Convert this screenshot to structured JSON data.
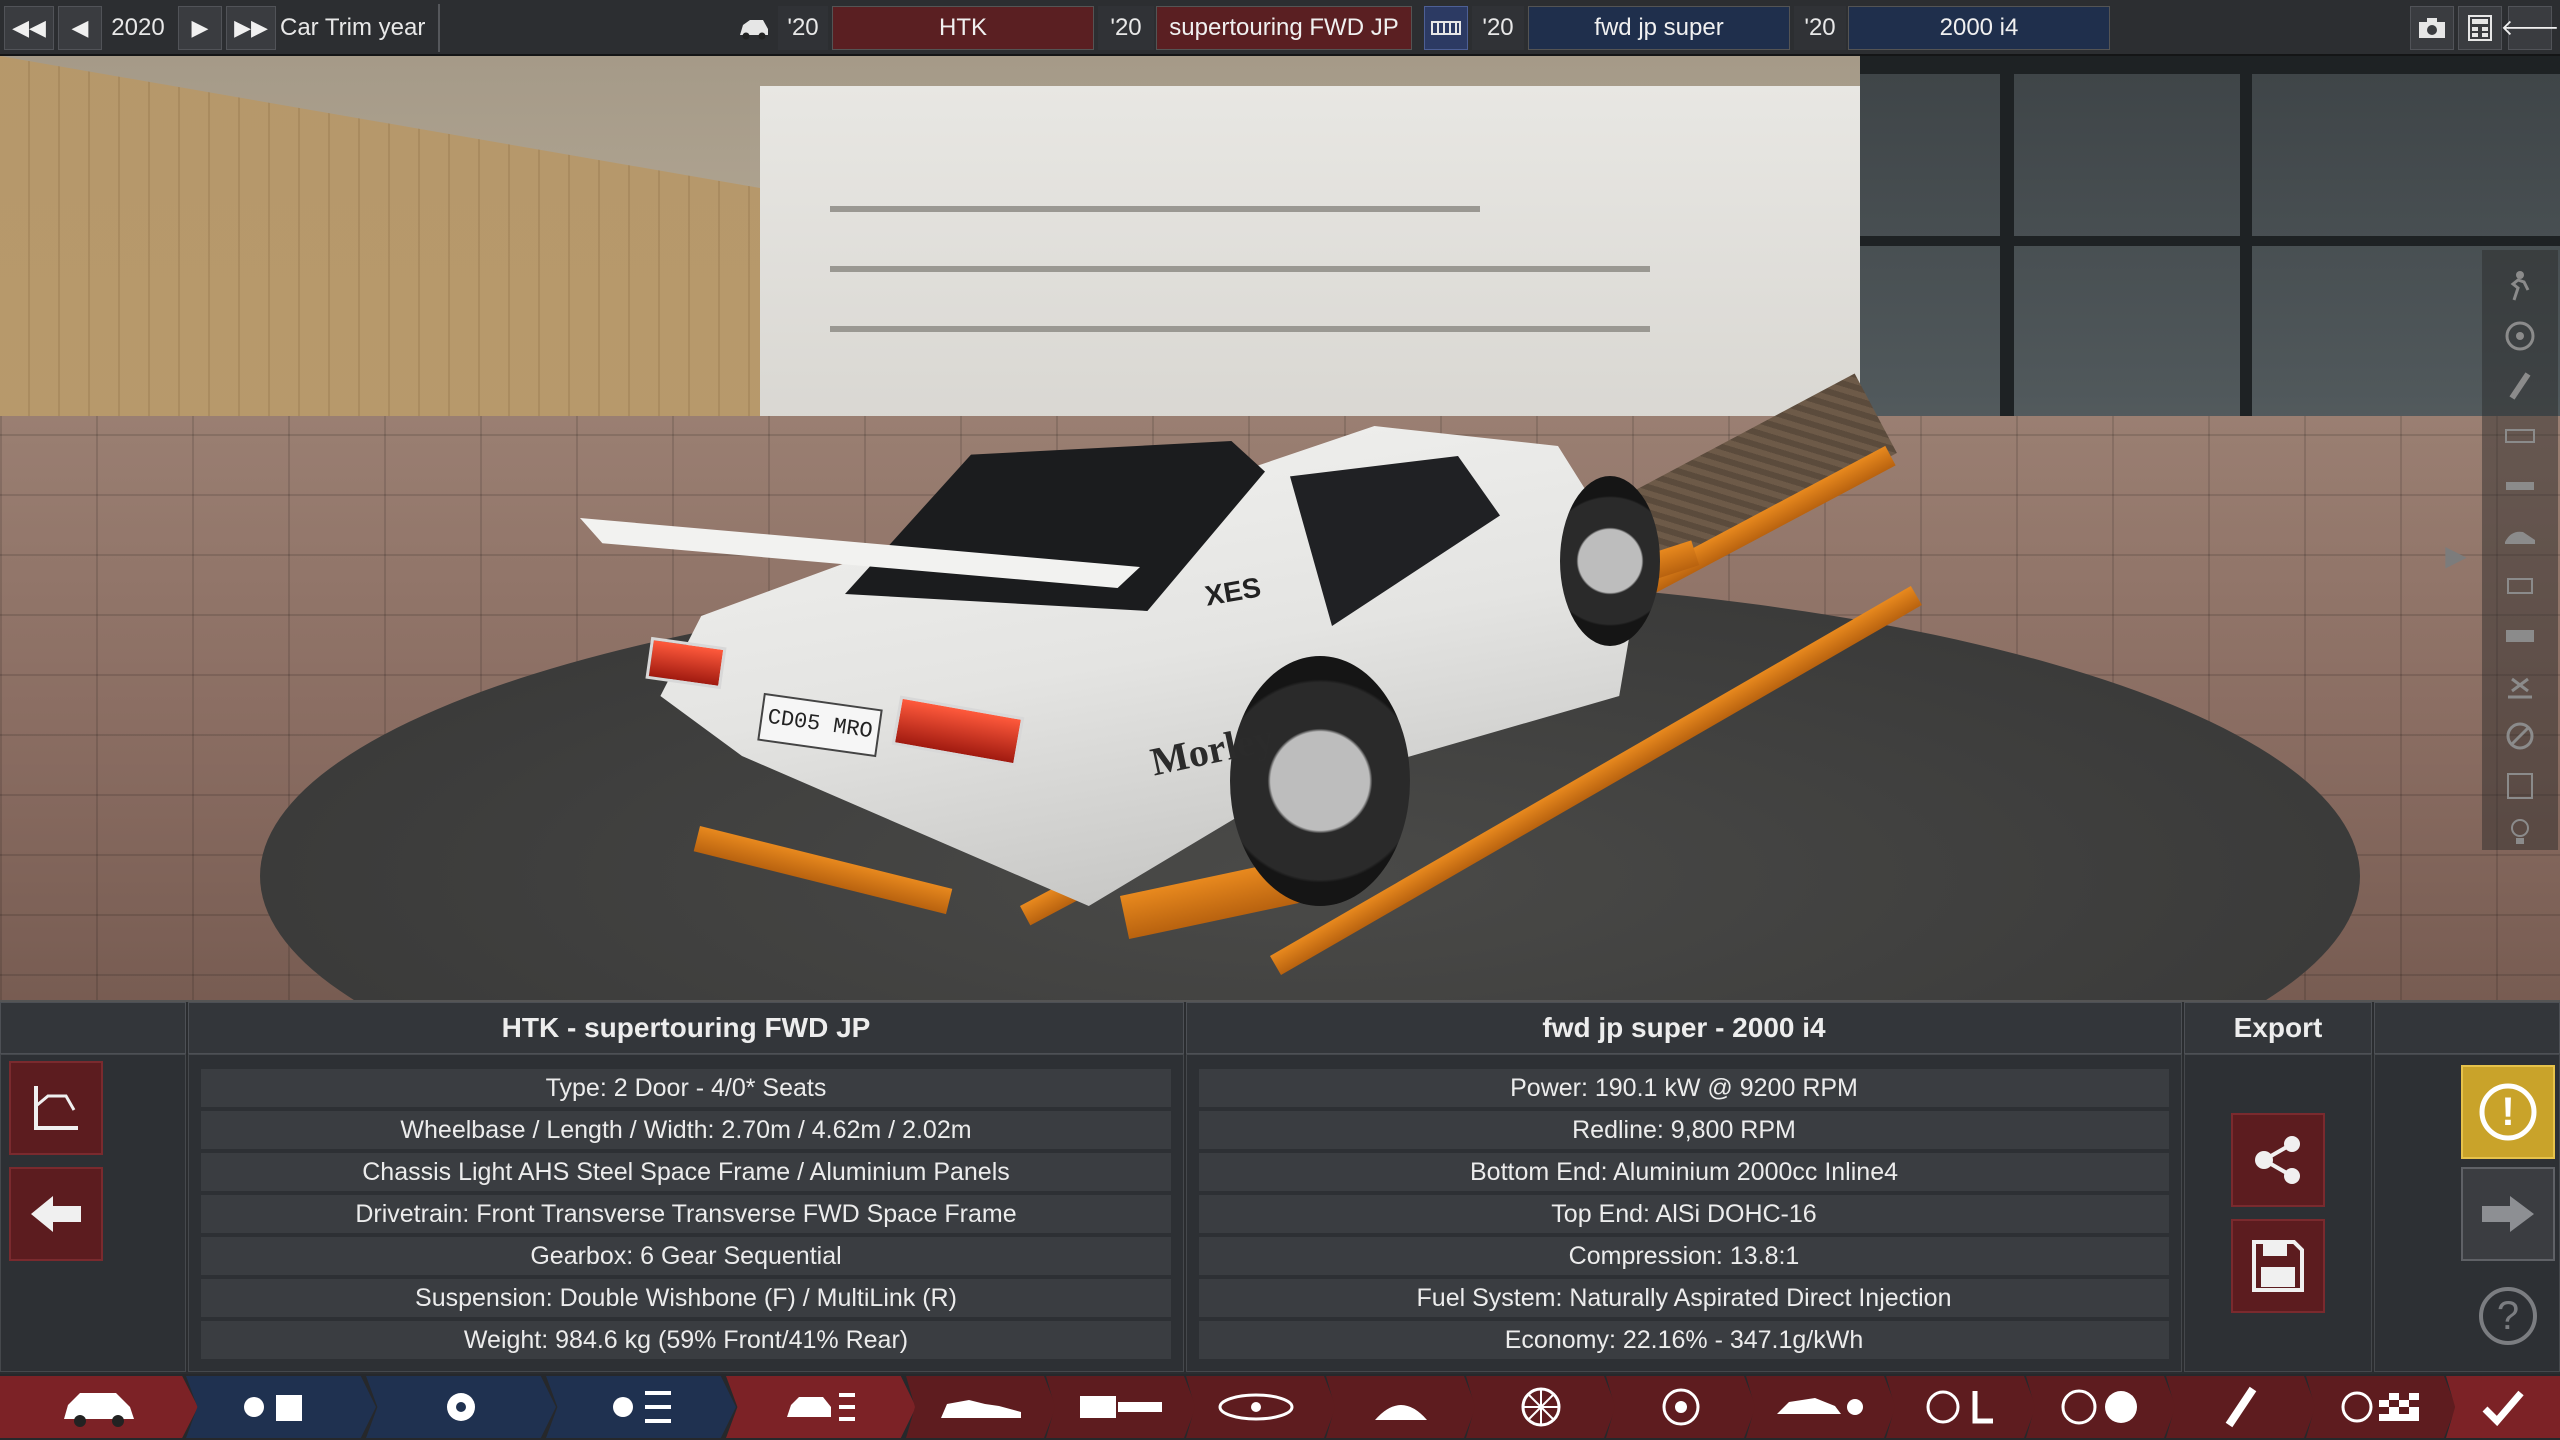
{
  "topbar": {
    "year": "2020",
    "car_trim_year_label": "Car Trim year",
    "model_year": "'20",
    "model_name": "HTK",
    "trim_year": "'20",
    "trim_name": "supertouring FWD JP",
    "engine_family_year": "'20",
    "engine_family_name": "fwd jp super",
    "engine_variant_year": "'20",
    "engine_variant_name": "2000 i4",
    "glyphs": {
      "rewind": "◀◀",
      "back": "◀",
      "forward": "▶",
      "fast_forward": "▶▶",
      "return": "🡐"
    }
  },
  "car_plate": "CD05 MRO",
  "car_decal": "Morley",
  "car_decal_small": "XES",
  "side_arrow": "▶",
  "car_panel": {
    "title": "HTK - supertouring FWD JP",
    "rows": [
      "Type: 2 Door - 4/0* Seats",
      "Wheelbase / Length / Width: 2.70m / 4.62m / 2.02m",
      "Chassis Light AHS Steel Space Frame / Aluminium Panels",
      "Drivetrain: Front Transverse Transverse FWD Space Frame",
      "Gearbox: 6 Gear Sequential",
      "Suspension: Double Wishbone (F) / MultiLink (R)",
      "Weight: 984.6 kg (59% Front/41% Rear)"
    ]
  },
  "engine_panel": {
    "title": "fwd jp super - 2000 i4",
    "rows": [
      "Power: 190.1 kW @ 9200 RPM",
      "Redline:  9,800 RPM",
      "Bottom End: Aluminium 2000cc Inline4",
      "Top End: AlSi DOHC-16",
      "Compression: 13.8:1",
      "Fuel System: Naturally Aspirated Direct Injection",
      "Economy: 22.16% - 347.1g/kWh"
    ]
  },
  "export_panel": {
    "title": "Export"
  },
  "help_glyph": "?",
  "warn_glyph": "!",
  "colors": {
    "accent_red": "#7c2226",
    "accent_blue": "#1f3150",
    "warning_yellow": "#c9a32a"
  }
}
